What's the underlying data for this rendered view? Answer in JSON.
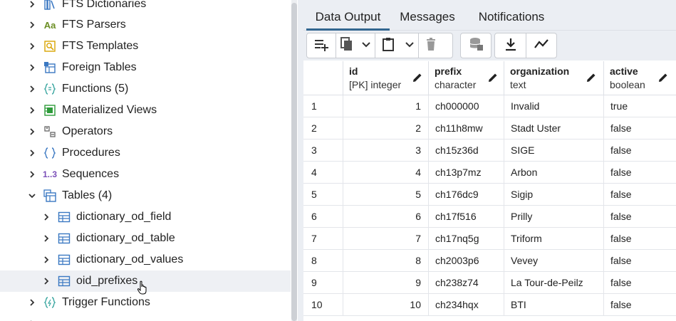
{
  "tree": {
    "items": [
      {
        "label": "FTS Dictionaries",
        "icon": "fts-dictionaries-icon",
        "expanded": false
      },
      {
        "label": "FTS Parsers",
        "icon_text": "Aa",
        "icon": "fts-parsers-icon",
        "expanded": false
      },
      {
        "label": "FTS Templates",
        "icon": "fts-templates-icon",
        "expanded": false
      },
      {
        "label": "Foreign Tables",
        "icon": "foreign-tables-icon",
        "expanded": false
      },
      {
        "label": "Functions (5)",
        "icon": "functions-icon",
        "expanded": false
      },
      {
        "label": "Materialized Views",
        "icon": "materialized-views-icon",
        "expanded": false
      },
      {
        "label": "Operators",
        "icon": "operators-icon",
        "expanded": false
      },
      {
        "label": "Procedures",
        "icon": "procedures-icon",
        "expanded": false
      },
      {
        "label": "Sequences",
        "icon_text": "1..3",
        "icon": "sequences-icon",
        "expanded": false
      },
      {
        "label": "Tables (4)",
        "icon": "tables-icon",
        "expanded": true
      },
      {
        "label": "dictionary_od_field",
        "icon": "table-icon",
        "expanded": false
      },
      {
        "label": "dictionary_od_table",
        "icon": "table-icon",
        "expanded": false
      },
      {
        "label": "dictionary_od_values",
        "icon": "table-icon",
        "expanded": false
      },
      {
        "label": "oid_prefixes",
        "icon": "table-icon",
        "expanded": false,
        "selected": true
      },
      {
        "label": "Trigger Functions",
        "icon": "trigger-functions-icon",
        "expanded": false
      }
    ]
  },
  "tabs": [
    {
      "label": "Data Output",
      "active": true
    },
    {
      "label": "Messages",
      "active": false
    },
    {
      "label": "Notifications",
      "active": false
    }
  ],
  "toolbar": {
    "buttons": [
      "add-row-icon",
      "copy-icon",
      "chevron-down-icon",
      "paste-icon",
      "chevron-down-icon",
      "delete-icon",
      "save-data-icon",
      "download-icon",
      "graph-icon"
    ]
  },
  "grid": {
    "columns": [
      {
        "name": "id",
        "type": "[PK] integer"
      },
      {
        "name": "prefix",
        "type": "character"
      },
      {
        "name": "organization",
        "type": "text"
      },
      {
        "name": "active",
        "type": "boolean"
      }
    ],
    "rows": [
      {
        "n": "1",
        "id": "1",
        "prefix": "ch000000",
        "organization": "Invalid",
        "active": "true"
      },
      {
        "n": "2",
        "id": "2",
        "prefix": "ch11h8mw",
        "organization": "Stadt Uster",
        "active": "false"
      },
      {
        "n": "3",
        "id": "3",
        "prefix": "ch15z36d",
        "organization": "SIGE",
        "active": "false"
      },
      {
        "n": "4",
        "id": "4",
        "prefix": "ch13p7mz",
        "organization": "Arbon",
        "active": "false"
      },
      {
        "n": "5",
        "id": "5",
        "prefix": "ch176dc9",
        "organization": "Sigip",
        "active": "false"
      },
      {
        "n": "6",
        "id": "6",
        "prefix": "ch17f516",
        "organization": "Prilly",
        "active": "false"
      },
      {
        "n": "7",
        "id": "7",
        "prefix": "ch17nq5g",
        "organization": "Triform",
        "active": "false"
      },
      {
        "n": "8",
        "id": "8",
        "prefix": "ch2003p6",
        "organization": "Vevey",
        "active": "false"
      },
      {
        "n": "9",
        "id": "9",
        "prefix": "ch238z74",
        "organization": "La Tour-de-Peilz",
        "active": "false"
      },
      {
        "n": "10",
        "id": "10",
        "prefix": "ch234hqx",
        "organization": "BTI",
        "active": "false"
      }
    ]
  },
  "colors": {
    "accent": "#326690",
    "panel_bg": "#ebeef3",
    "selected_row": "#eef0f4"
  }
}
